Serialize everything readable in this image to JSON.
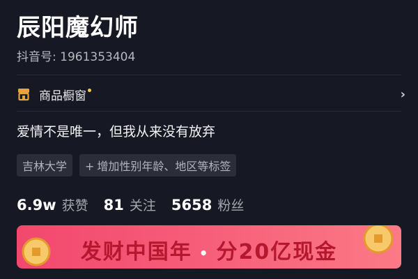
{
  "profile": {
    "name": "辰阳魔幻师",
    "douyin_id_label": "抖音号: 1961353404"
  },
  "shop": {
    "label": "商品橱窗",
    "icon": "shop-window-icon",
    "dot_color": "#f2c94c"
  },
  "bio": "爱情不是唯一，但我从来没有放弃",
  "tags": [
    {
      "label": "吉林大学"
    },
    {
      "prefix": "+",
      "label": "增加性别年龄、地区等标签"
    }
  ],
  "stats": {
    "likes": {
      "value": "6.9w",
      "label": "获赞"
    },
    "following": {
      "value": "81",
      "label": "关注"
    },
    "followers": {
      "value": "5658",
      "label": "粉丝"
    }
  },
  "banner": {
    "title_left": "发财中国年",
    "separator": "•",
    "title_right": "分20亿现金",
    "colors": {
      "start": "#f2486e",
      "end": "#fb7a86",
      "text": "#b4172e"
    }
  },
  "colors": {
    "background": "#161823",
    "accent_gold": "#e8a33a"
  }
}
